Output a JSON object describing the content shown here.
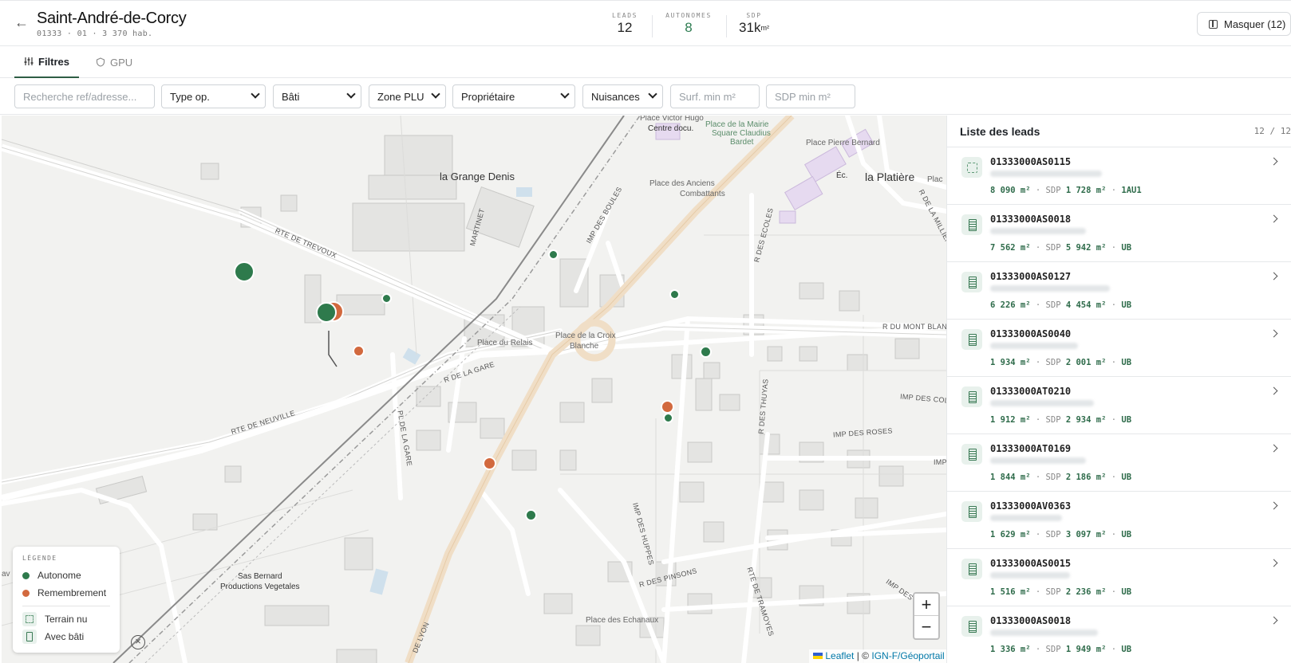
{
  "header": {
    "back_icon": "arrow-left-icon",
    "title": "Saint-André-de-Corcy",
    "subtitle": "01333 · 01 · 3 370 hab.",
    "stats": {
      "leads_label": "LEADS",
      "leads_value": "12",
      "autonomes_label": "AUTONOMES",
      "autonomes_value": "8",
      "sdp_label": "SDP",
      "sdp_value": "31k",
      "sdp_unit": "m²"
    },
    "hide_button_label": "Masquer (12)"
  },
  "tabs": [
    {
      "label": "Filtres",
      "icon": "sliders-icon",
      "active": true
    },
    {
      "label": "GPU",
      "icon": "shield-icon",
      "active": false
    }
  ],
  "filters": {
    "search_placeholder": "Recherche ref/adresse...",
    "type_op": "Type op.",
    "bati": "Bâti",
    "zone_plu": "Zone PLU",
    "proprietaire": "Propriétaire",
    "nuisances": "Nuisances",
    "surf_min_placeholder": "Surf. min m²",
    "sdp_min_placeholder": "SDP min m²"
  },
  "map": {
    "places": {
      "grange_denis": "la Grange Denis",
      "platiere": "la Platière",
      "place_victor_hugo": "Place Victor Hugo",
      "centre_docu": "Centre docu.",
      "place_mairie": "Place de la Mairie",
      "square_bardet": "Square Claudius",
      "bardet": "Bardet",
      "place_pierre_bernard": "Place Pierre Bernard",
      "place_anciens": "Place des Anciens",
      "combattants": "Combattants",
      "ec": "Éc.",
      "place_croix": "Place de la Croix",
      "blanche": "Blanche",
      "place_relais": "Place du Relais",
      "sas_bernard": "Sas Bernard",
      "productions": "Productions Vegetales",
      "place_echanaux": "Place des Echanaux",
      "plac": "Plac",
      "av": "av"
    },
    "roads": {
      "rte_trevoux": "RTE DE TREVOUX",
      "rte_neuville": "RTE DE NEUVILLE",
      "r_gare": "R DE LA GARE",
      "pl_gare": "PL DE LA GARE",
      "martinet": "MARTINET",
      "imp_boules": "IMP DES BOULES",
      "r_ecoles": "R DES ECOLES",
      "r_milliere": "R DE LA MILLIERE",
      "r_mont_blanc": "R DU MONT BLANC",
      "r_thuyas": "R DES THUYAS",
      "imp_roses": "IMP DES ROSES",
      "imp_col": "IMP DES COL",
      "imp_huppes": "IMP DES HUPPES",
      "r_pinsons": "R DES PINSONS",
      "rte_tramoyes": "RTE DE TRAMOYES",
      "de_lyon": "DE LYON",
      "imp_des": "IMP DES",
      "imp": "IMP"
    },
    "legend": {
      "title": "LÉGENDE",
      "autonome": "Autonome",
      "remembrement": "Remembrement",
      "terrain_nu": "Terrain nu",
      "avec_bati": "Avec bâti"
    },
    "zoom_in": "+",
    "zoom_out": "−",
    "attribution_leaflet": "Leaflet",
    "attribution_sep": "| ©",
    "attribution_ign": "IGN-F/Géoportail",
    "colors": {
      "autonome": "#2e7a4c",
      "remembrement": "#d2693e"
    }
  },
  "list": {
    "title": "Liste des leads",
    "count": "12 / 12",
    "sdp_label": "SDP",
    "leads": [
      {
        "ref": "01333000AS0115",
        "surface": "8 090 m²",
        "sdp": "1 728 m²",
        "zone": "1AU1",
        "type": "terrain-nu"
      },
      {
        "ref": "01333000AS0018",
        "surface": "7 562 m²",
        "sdp": "5 942 m²",
        "zone": "UB",
        "type": "bati"
      },
      {
        "ref": "01333000AS0127",
        "surface": "6 226 m²",
        "sdp": "4 454 m²",
        "zone": "UB",
        "type": "bati"
      },
      {
        "ref": "01333000AS0040",
        "surface": "1 934 m²",
        "sdp": "2 001 m²",
        "zone": "UB",
        "type": "bati"
      },
      {
        "ref": "01333000AT0210",
        "surface": "1 912 m²",
        "sdp": "2 934 m²",
        "zone": "UB",
        "type": "bati"
      },
      {
        "ref": "01333000AT0169",
        "surface": "1 844 m²",
        "sdp": "2 186 m²",
        "zone": "UB",
        "type": "bati"
      },
      {
        "ref": "01333000AV0363",
        "surface": "1 629 m²",
        "sdp": "3 097 m²",
        "zone": "UB",
        "type": "bati"
      },
      {
        "ref": "01333000AS0015",
        "surface": "1 516 m²",
        "sdp": "2 236 m²",
        "zone": "UB",
        "type": "bati"
      },
      {
        "ref": "01333000AS0018",
        "surface": "1 336 m²",
        "sdp": "1 949 m²",
        "zone": "UB",
        "type": "bati"
      }
    ]
  }
}
